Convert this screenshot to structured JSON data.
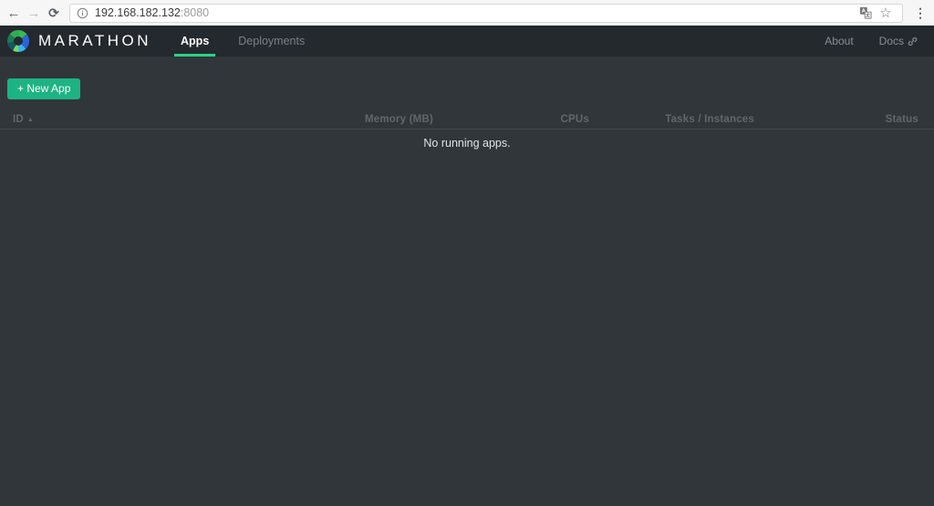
{
  "browser": {
    "back_icon": "←",
    "forward_icon": "→",
    "reload_icon": "⟳",
    "bookmark_icon": "☆",
    "menu_icon": "⋮",
    "url": {
      "host": "192.168.182.132",
      "port": ":8080"
    }
  },
  "navbar": {
    "brand": "MARATHON",
    "tabs": [
      {
        "label": "Apps",
        "active": true
      },
      {
        "label": "Deployments",
        "active": false
      }
    ],
    "links": [
      {
        "label": "About"
      },
      {
        "label": "Docs"
      }
    ]
  },
  "content": {
    "new_app_button": "+ New App",
    "table": {
      "columns": [
        "ID",
        "Memory (MB)",
        "CPUs",
        "Tasks / Instances",
        "Status"
      ],
      "sort_indicator": "▲",
      "rows": [],
      "empty_message": "No running apps."
    }
  },
  "colors": {
    "navbar_bg": "#24292e",
    "body_bg": "#31363b",
    "accent_green": "#1eb382",
    "active_tab_underline": "#2bd284",
    "table_header_text": "#61676c"
  }
}
